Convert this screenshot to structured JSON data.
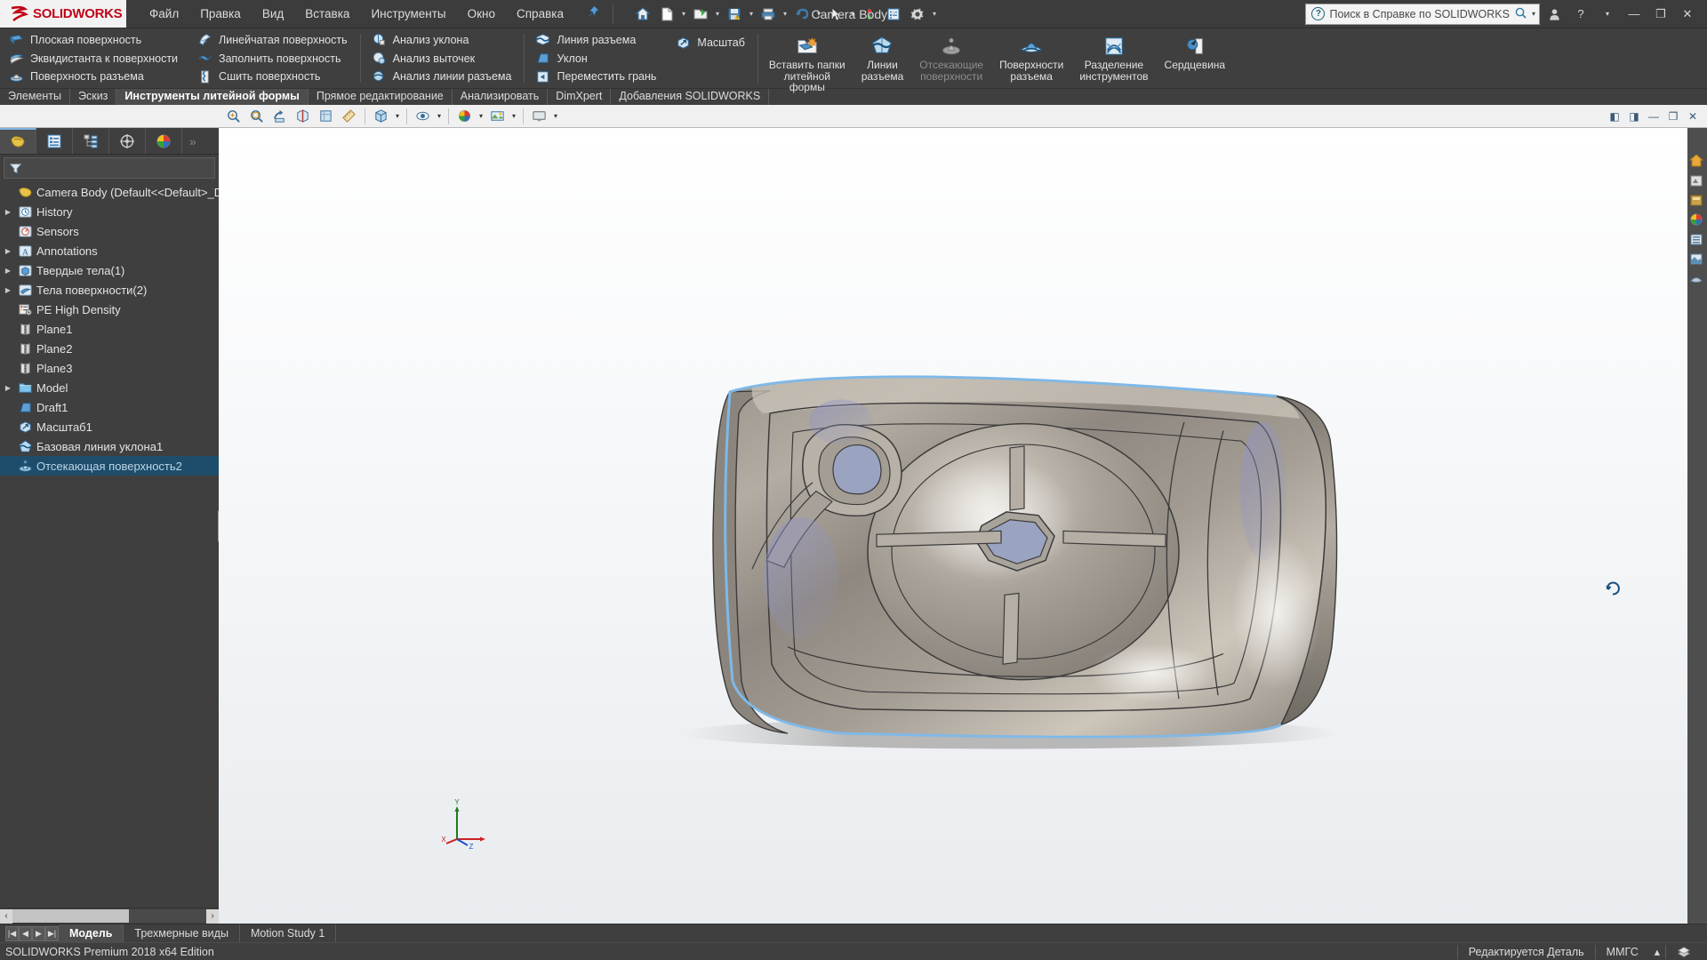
{
  "titlebar": {
    "logo_ds": "3DS",
    "logo_solid": "SOLID",
    "logo_works": "WORKS",
    "document_title": "Camera Body *",
    "menus": [
      "Файл",
      "Правка",
      "Вид",
      "Вставка",
      "Инструменты",
      "Окно",
      "Справка"
    ],
    "pin_icon": "pin-icon",
    "quick_access": [
      {
        "name": "home-icon",
        "caret": false
      },
      {
        "name": "new-document-icon",
        "caret": true
      },
      {
        "name": "open-folder-icon",
        "caret": true
      },
      {
        "name": "save-icon",
        "caret": true
      },
      {
        "name": "print-icon",
        "caret": true
      },
      {
        "name": "undo-icon",
        "caret": true
      },
      {
        "name": "select-arrow-icon",
        "caret": true
      },
      {
        "name": "rebuild-icon",
        "caret": false
      },
      {
        "name": "options-list-icon",
        "caret": false
      },
      {
        "name": "gear-icon",
        "caret": true
      }
    ],
    "search": {
      "placeholder": "Поиск в Справке по SOLIDWORKS",
      "icon": "help-question-icon",
      "mag_icon": "magnifier-icon"
    },
    "window_buttons": [
      {
        "name": "user-account-icon",
        "glyph": "☰"
      },
      {
        "name": "help-icon",
        "glyph": "?"
      },
      {
        "name": "help-dropdown-caret-icon",
        "glyph": "▾"
      },
      {
        "name": "minimize-button",
        "glyph": "—"
      },
      {
        "name": "restore-button",
        "glyph": "❐"
      },
      {
        "name": "close-button",
        "glyph": "✕"
      }
    ]
  },
  "ribbon": {
    "group_surfaces": [
      {
        "label": "Плоская поверхность",
        "icon": "planar-surface-icon"
      },
      {
        "label": "Эквидистанта к поверхности",
        "icon": "offset-surface-icon"
      },
      {
        "label": "Поверхность разъема",
        "icon": "parting-surface-icon"
      }
    ],
    "group_surfaces2": [
      {
        "label": "Линейчатая поверхность",
        "icon": "ruled-surface-icon"
      },
      {
        "label": "Заполнить поверхность",
        "icon": "filled-surface-icon"
      },
      {
        "label": "Сшить поверхность",
        "icon": "knit-surface-icon"
      }
    ],
    "group_analysis": [
      {
        "label": "Анализ уклона",
        "icon": "draft-analysis-icon"
      },
      {
        "label": "Анализ выточек",
        "icon": "undercut-analysis-icon"
      },
      {
        "label": "Анализ линии разъема",
        "icon": "parting-line-analysis-icon"
      }
    ],
    "group_tools": [
      {
        "label": "Линия разъема",
        "icon": "parting-line-icon"
      },
      {
        "label": "Уклон",
        "icon": "draft-icon"
      },
      {
        "label": "Переместить грань",
        "icon": "move-face-icon"
      }
    ],
    "group_scale": [
      {
        "label": "Масштаб",
        "icon": "scale-icon"
      }
    ],
    "group_big": [
      {
        "label": "Вставить папки\nлитейной\nформы",
        "icon": "insert-mold-folders-icon",
        "disabled": false
      },
      {
        "label": "Линии\nразъема",
        "icon": "parting-lines-big-icon",
        "disabled": false
      },
      {
        "label": "Отсекающие\nповерхности",
        "icon": "shut-off-surfaces-icon",
        "disabled": true
      },
      {
        "label": "Поверхности\nразъема",
        "icon": "parting-surfaces-big-icon",
        "disabled": false
      },
      {
        "label": "Разделение\nинструментов",
        "icon": "tooling-split-icon",
        "disabled": false
      },
      {
        "label": "Сердцевина",
        "icon": "core-icon",
        "disabled": false
      }
    ]
  },
  "tabs": [
    {
      "label": "Элементы",
      "active": false
    },
    {
      "label": "Эскиз",
      "active": false
    },
    {
      "label": "Инструменты литейной формы",
      "active": true
    },
    {
      "label": "Прямое редактирование",
      "active": false
    },
    {
      "label": "Анализировать",
      "active": false
    },
    {
      "label": "DimXpert",
      "active": false
    },
    {
      "label": "Добавления SOLIDWORKS",
      "active": false
    }
  ],
  "viewbar": {
    "buttons": [
      {
        "name": "zoom-to-fit-icon",
        "caret": false
      },
      {
        "name": "zoom-to-area-icon",
        "caret": false
      },
      {
        "name": "section-view-icon",
        "caret": false
      },
      {
        "name": "view-orientation-icon",
        "caret": false
      },
      {
        "name": "measure-icon",
        "caret": false
      },
      {
        "name": "view-settings-icon",
        "caret": false
      },
      {
        "name": "display-style-icon",
        "caret": true
      },
      {
        "name": "hide-show-items-icon",
        "caret": true
      },
      {
        "name": "edit-appearance-icon",
        "caret": true
      },
      {
        "name": "apply-scene-icon",
        "caret": true
      },
      {
        "name": "view-setting-display-icon",
        "caret": true
      }
    ],
    "right_buttons": [
      {
        "name": "restore-viewport-left-icon"
      },
      {
        "name": "restore-viewport-right-icon"
      },
      {
        "name": "minimize-document-icon"
      },
      {
        "name": "restore-document-icon"
      },
      {
        "name": "close-document-icon"
      }
    ]
  },
  "feature_manager": {
    "tabs": [
      {
        "name": "feature-manager-tab",
        "icon": "feature-tree-icon",
        "active": true
      },
      {
        "name": "property-manager-tab",
        "icon": "property-manager-icon",
        "active": false
      },
      {
        "name": "configuration-manager-tab",
        "icon": "configuration-manager-icon",
        "active": false
      },
      {
        "name": "dimxpert-manager-tab",
        "icon": "dimxpert-icon",
        "active": false
      },
      {
        "name": "display-manager-tab",
        "icon": "display-manager-icon",
        "active": false
      }
    ],
    "filter": {
      "icon": "filter-funnel-icon",
      "placeholder": ""
    },
    "tree": [
      {
        "label": "Camera Body  (Default<<Default>_Displa",
        "icon": "part-icon",
        "arrow": false,
        "indent": 0,
        "selected": false,
        "root": true
      },
      {
        "label": "History",
        "icon": "history-icon",
        "arrow": true,
        "indent": 1,
        "selected": false
      },
      {
        "label": "Sensors",
        "icon": "sensors-icon",
        "arrow": false,
        "indent": 1,
        "selected": false
      },
      {
        "label": "Annotations",
        "icon": "annotations-icon",
        "arrow": true,
        "indent": 1,
        "selected": false
      },
      {
        "label": "Твердые тела(1)",
        "icon": "solid-bodies-icon",
        "arrow": true,
        "indent": 1,
        "selected": false
      },
      {
        "label": "Тела поверхности(2)",
        "icon": "surface-bodies-icon",
        "arrow": true,
        "indent": 1,
        "selected": false
      },
      {
        "label": "PE High Density",
        "icon": "material-icon",
        "arrow": false,
        "indent": 1,
        "selected": false
      },
      {
        "label": "Plane1",
        "icon": "plane-icon",
        "arrow": false,
        "indent": 1,
        "selected": false
      },
      {
        "label": "Plane2",
        "icon": "plane-icon",
        "arrow": false,
        "indent": 1,
        "selected": false
      },
      {
        "label": "Plane3",
        "icon": "plane-icon",
        "arrow": false,
        "indent": 1,
        "selected": false
      },
      {
        "label": "Model",
        "icon": "folder-icon",
        "arrow": true,
        "indent": 1,
        "selected": false
      },
      {
        "label": "Draft1",
        "icon": "draft-feature-icon",
        "arrow": false,
        "indent": 1,
        "selected": false
      },
      {
        "label": "Масштаб1",
        "icon": "scale-feature-icon",
        "arrow": false,
        "indent": 1,
        "selected": false
      },
      {
        "label": "Базовая линия уклона1",
        "icon": "parting-line-feature-icon",
        "arrow": false,
        "indent": 1,
        "selected": false
      },
      {
        "label": "Отсекающая поверхность2",
        "icon": "shutoff-surface-feature-icon",
        "arrow": false,
        "indent": 1,
        "selected": true
      }
    ]
  },
  "graphics": {
    "triad_labels": [
      "Y",
      "X",
      "Z"
    ],
    "cursor_icon": "rotate-cursor-icon",
    "right_dock": [
      {
        "name": "view-home-icon"
      },
      {
        "name": "appearance-dock-icon"
      },
      {
        "name": "scene-dock-icon"
      },
      {
        "name": "decal-dock-icon"
      },
      {
        "name": "lights-dock-icon"
      },
      {
        "name": "camera-dock-icon"
      },
      {
        "name": "walkthrough-dock-icon"
      }
    ]
  },
  "study_bar": {
    "nav_buttons": [
      "first-tab-icon",
      "prev-tab-icon",
      "next-tab-icon",
      "last-tab-icon"
    ],
    "tabs": [
      {
        "label": "Модель",
        "active": true
      },
      {
        "label": "Трехмерные виды",
        "active": false
      },
      {
        "label": "Motion Study 1",
        "active": false
      }
    ]
  },
  "status_bar": {
    "left_text": "SOLIDWORKS Premium 2018 x64 Edition",
    "editing_text": "Редактируется Деталь",
    "units_text": "ММГС",
    "units_caret": "▴",
    "end_icon": "overlay-icon"
  }
}
